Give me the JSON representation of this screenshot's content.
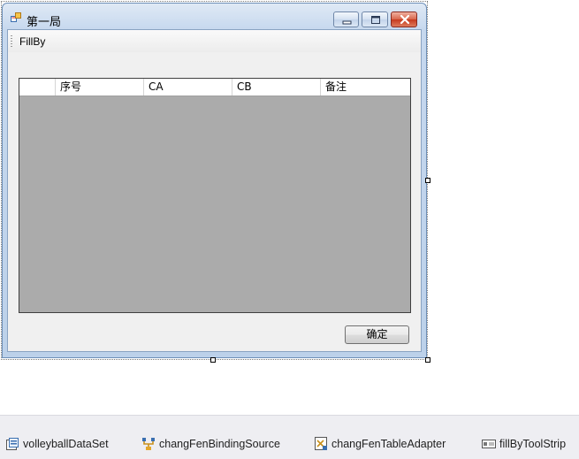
{
  "window": {
    "title": "第一局",
    "app_icon": "form-icon",
    "controls": [
      "minimize-icon",
      "maximize-icon",
      "close-icon"
    ]
  },
  "toolstrip": {
    "fill_label": "FillBy"
  },
  "grid": {
    "columns": [
      "序号",
      "CA",
      "CB",
      "备注"
    ],
    "rows": []
  },
  "buttons": {
    "ok_label": "确定"
  },
  "tray": {
    "items": [
      {
        "label": "volleyballDataSet",
        "icon": "dataset-icon"
      },
      {
        "label": "changFenBindingSource",
        "icon": "binding-source-icon"
      },
      {
        "label": "changFenTableAdapter",
        "icon": "table-adapter-icon"
      },
      {
        "label": "fillByToolStrip",
        "icon": "toolstrip-icon"
      }
    ]
  },
  "colors": {
    "grid_background": "#ababab",
    "client_background": "#f0f0f0",
    "close_button": "#c6391d"
  }
}
